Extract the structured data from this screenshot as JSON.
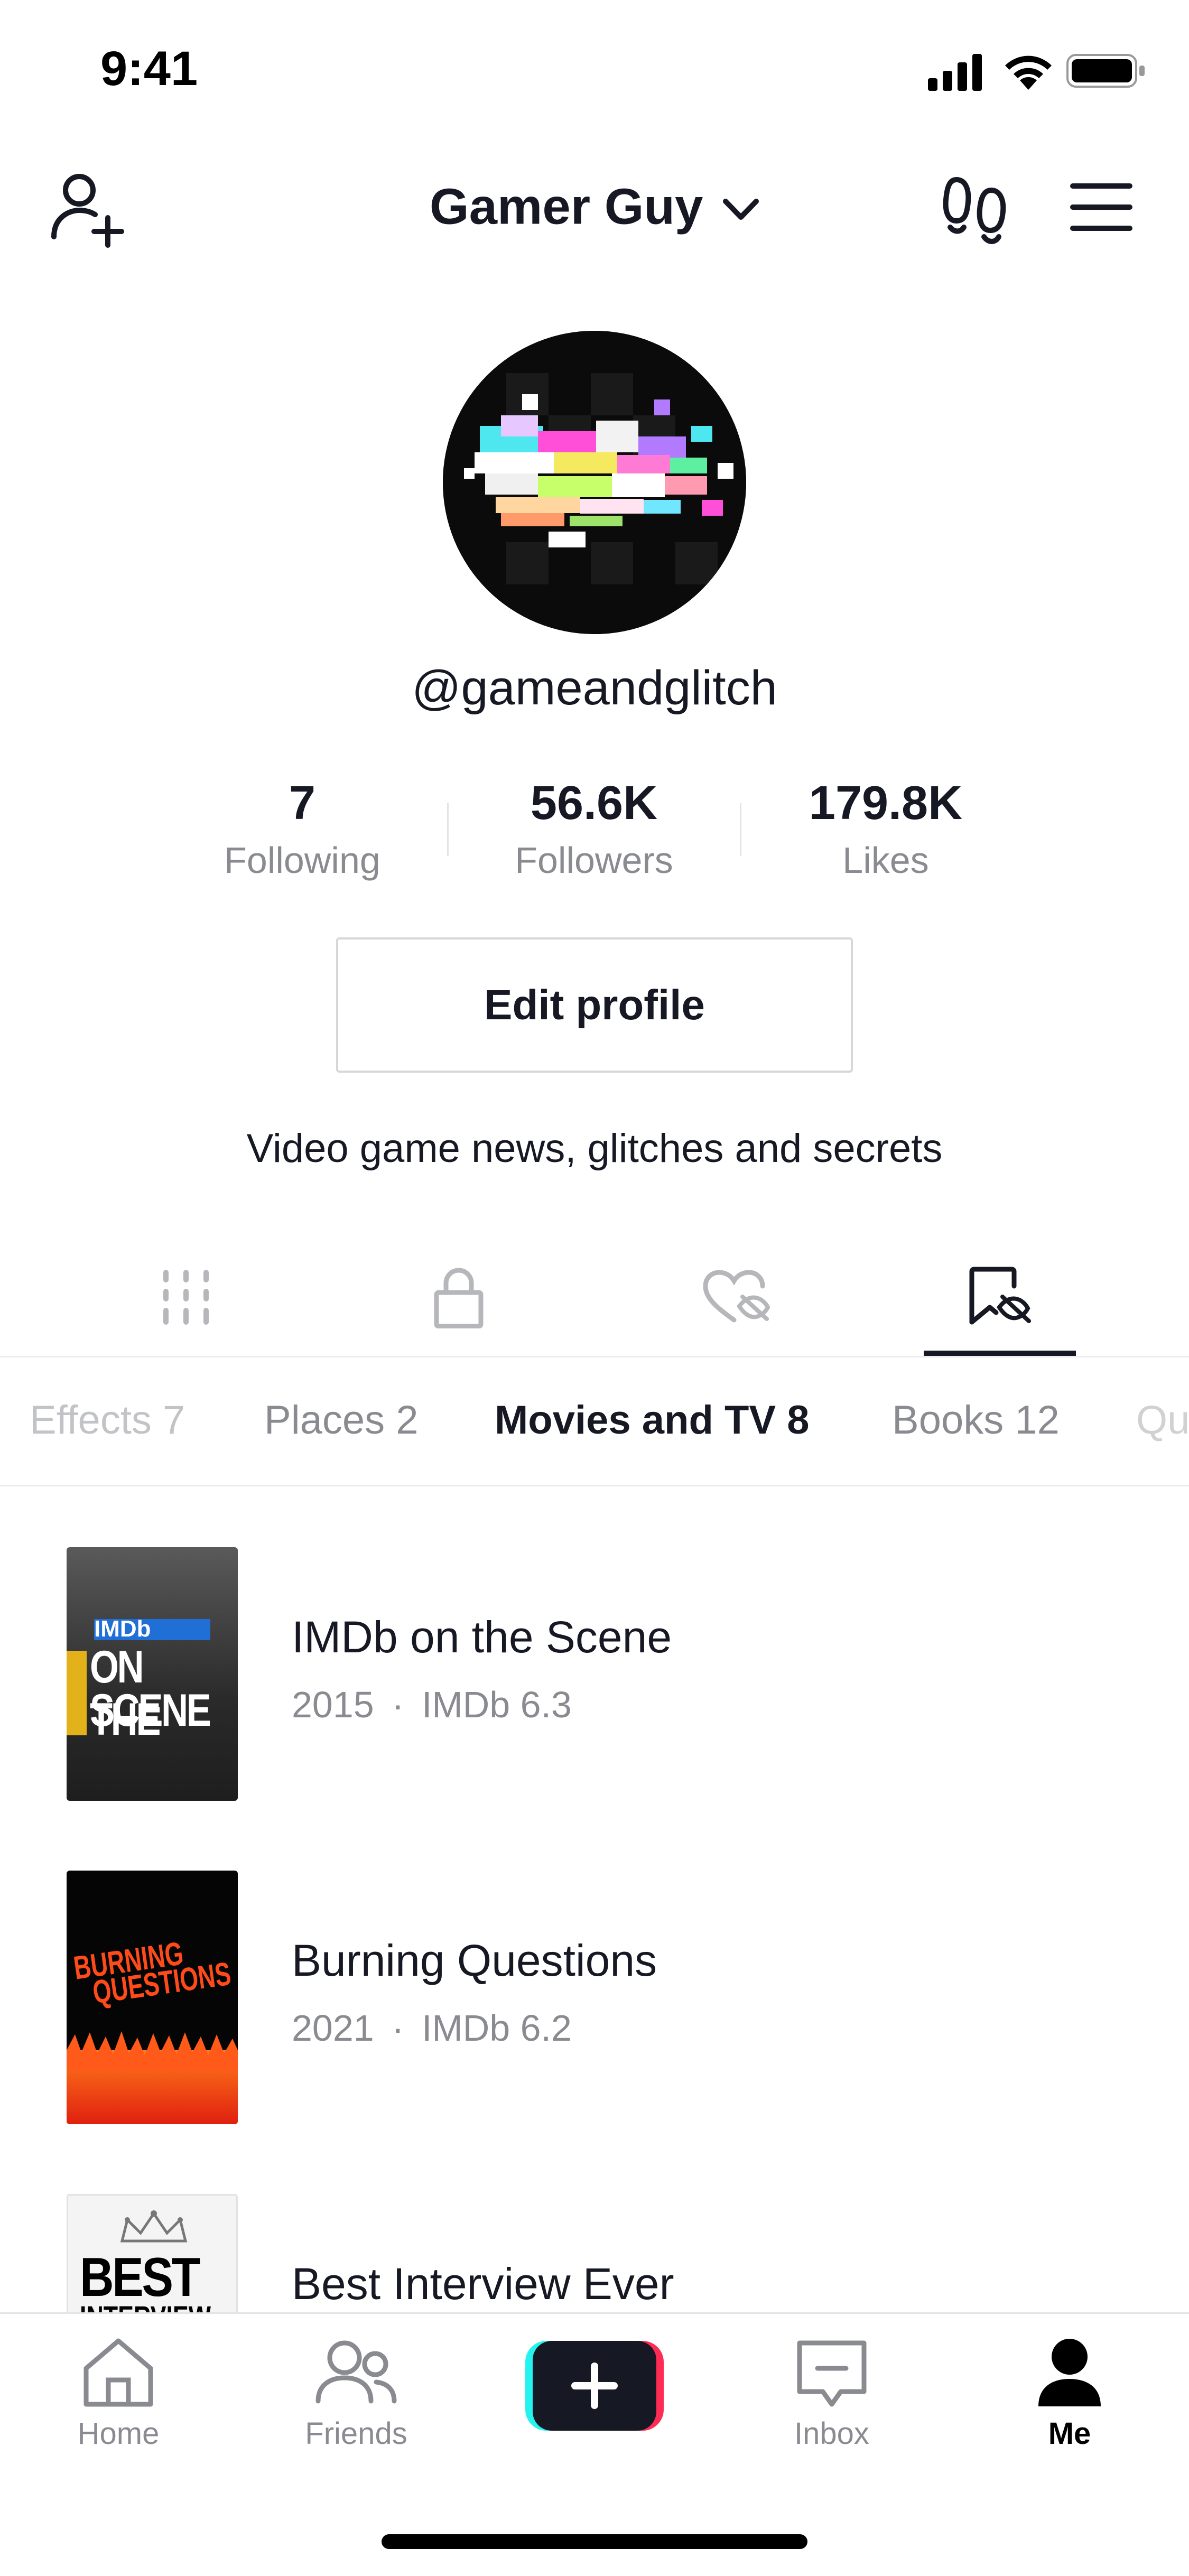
{
  "status_bar": {
    "time": "9:41",
    "icons": [
      "signal-icon",
      "wifi-icon",
      "battery-icon"
    ]
  },
  "header": {
    "title": "Gamer Guy",
    "left_icon": "add-user-icon",
    "right_icons": [
      "footprints-icon",
      "menu-icon"
    ],
    "title_icon": "chevron-down-icon"
  },
  "profile": {
    "username": "@gameandglitch",
    "stats": [
      {
        "value": "7",
        "label": "Following"
      },
      {
        "value": "56.6K",
        "label": "Followers"
      },
      {
        "value": "179.8K",
        "label": "Likes"
      }
    ],
    "edit_button": "Edit profile",
    "bio": "Video game news, glitches and secrets"
  },
  "tabs": [
    {
      "icon": "grid-icon",
      "active": false
    },
    {
      "icon": "lock-icon",
      "active": false
    },
    {
      "icon": "heart-hidden-icon",
      "active": false
    },
    {
      "icon": "bookmark-hidden-icon",
      "active": true
    }
  ],
  "categories": [
    {
      "label": "Effects 7",
      "active": false
    },
    {
      "label": "Places 2",
      "active": false
    },
    {
      "label": "Movies and TV 8",
      "active": true
    },
    {
      "label": "Books 12",
      "active": false
    },
    {
      "label": "Qu",
      "active": false
    }
  ],
  "items": [
    {
      "title": "IMDb on the Scene",
      "year": "2015",
      "rating": "IMDb 6.3",
      "poster_text": [
        "IMDb",
        "ON THE",
        "SCENE"
      ]
    },
    {
      "title": "Burning Questions",
      "year": "2021",
      "rating": "IMDb 6.2",
      "poster_text": [
        "BURNING",
        "QUESTIONS"
      ]
    },
    {
      "title": "Best Interview Ever",
      "year": "",
      "rating": "",
      "poster_text": [
        "BEST",
        "INTERVIEW"
      ]
    }
  ],
  "meta_separator": "·",
  "bottom_nav": [
    {
      "label": "Home",
      "icon": "home-icon",
      "active": false
    },
    {
      "label": "Friends",
      "icon": "friends-icon",
      "active": false
    },
    {
      "label": "",
      "icon": "plus-icon",
      "active": false
    },
    {
      "label": "Inbox",
      "icon": "inbox-icon",
      "active": false
    },
    {
      "label": "Me",
      "icon": "person-icon",
      "active": true
    }
  ],
  "colors": {
    "text_primary": "#161823",
    "text_secondary": "#8a8b91",
    "accent_cyan": "#25f4ee",
    "accent_pink": "#fe2c55"
  }
}
